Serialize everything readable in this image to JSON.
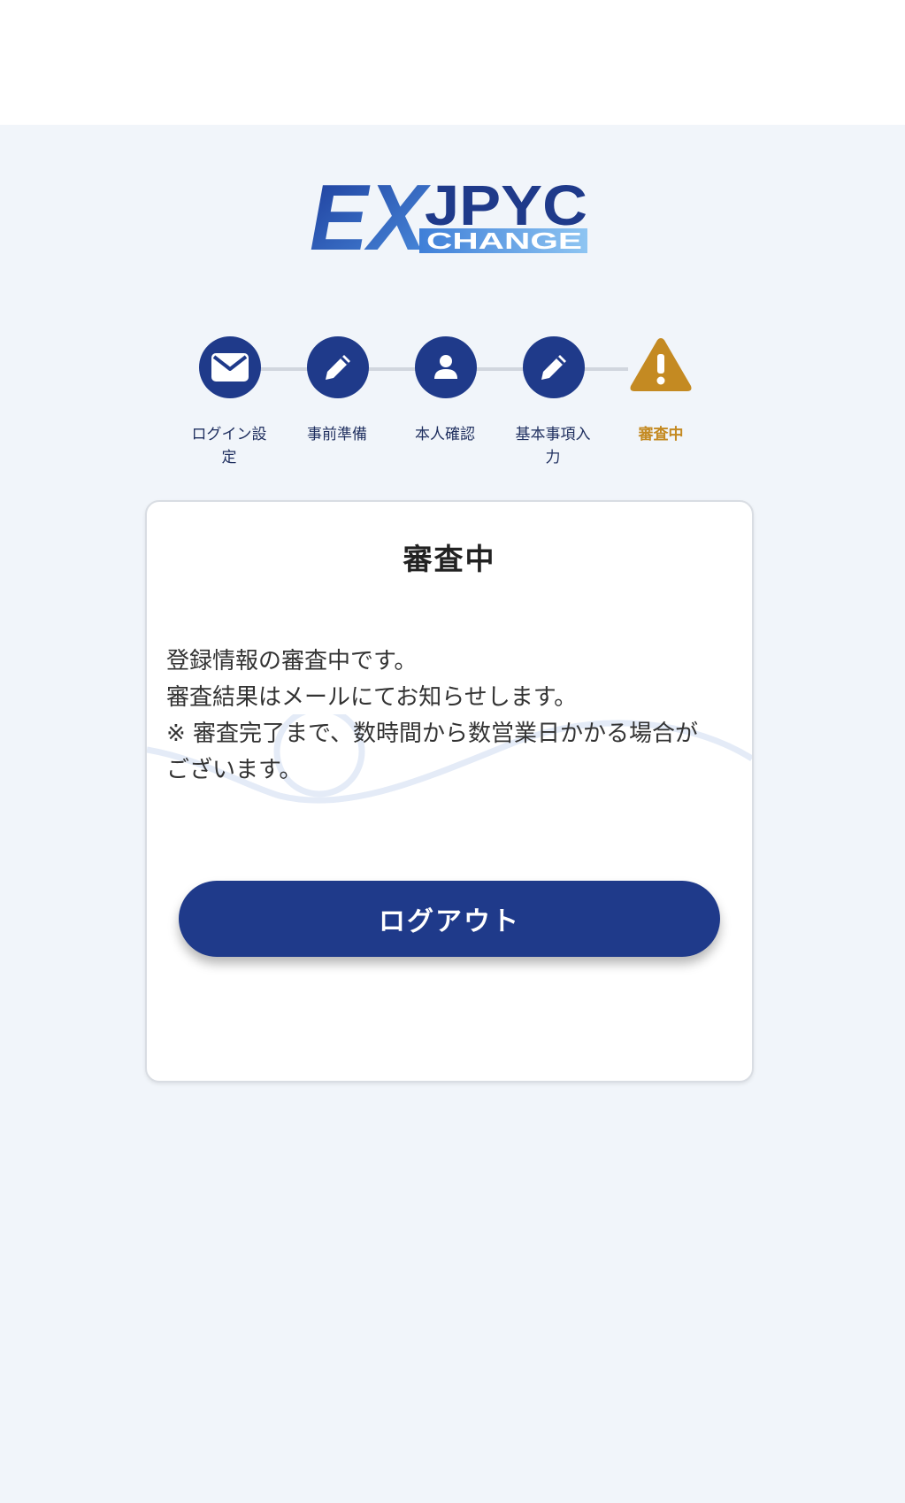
{
  "logo": {
    "text_ex": "EX",
    "text_jpyc": "JPYC",
    "text_change": "CHANGE"
  },
  "stepper": {
    "steps": [
      {
        "label_line1": "ログイン設",
        "label_line2": "定",
        "icon": "mail-icon"
      },
      {
        "label_line1": "事前準備",
        "label_line2": "",
        "icon": "pencil-icon"
      },
      {
        "label_line1": "本人確認",
        "label_line2": "",
        "icon": "person-icon"
      },
      {
        "label_line1": "基本事項入",
        "label_line2": "力",
        "icon": "pencil-icon"
      },
      {
        "label_line1": "審査中",
        "label_line2": "",
        "icon": "warning-icon"
      }
    ],
    "active_step": 5
  },
  "card": {
    "title": "審査中",
    "message_lines": [
      "登録情報の審査中です。",
      "審査結果はメールにてお知らせします。",
      "※ 審査完了まで、数時間から数営業日かかる場合が",
      "ございます。"
    ],
    "logout_label": "ログアウト"
  },
  "colors": {
    "primary": "#1f3a8a",
    "warning": "#c48a22",
    "background": "#f1f5fa"
  }
}
